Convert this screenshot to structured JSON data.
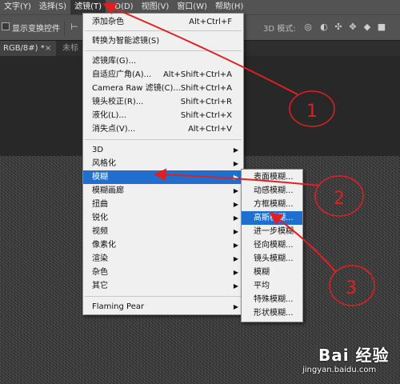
{
  "menubar": {
    "items": [
      "文字(Y)",
      "选择(S)",
      "滤镜(T)",
      "3D(D)",
      "视图(V)",
      "窗口(W)",
      "帮助(H)"
    ]
  },
  "options_bar": {
    "transform_label": "显示变换控件",
    "mode_label": "3D 模式:"
  },
  "tabs": [
    {
      "label": "RGB/8#) *",
      "close": "×"
    },
    {
      "label": "未标"
    }
  ],
  "filter_menu": {
    "items": [
      {
        "label": "添加杂色",
        "shortcut": "Alt+Ctrl+F"
      },
      {
        "label": "转换为智能滤镜(S)",
        "shortcut": ""
      },
      {
        "label": "滤镜库(G)...",
        "shortcut": ""
      },
      {
        "label": "自适应广角(A)...",
        "shortcut": "Alt+Shift+Ctrl+A"
      },
      {
        "label": "Camera Raw 滤镜(C)...",
        "shortcut": "Shift+Ctrl+A"
      },
      {
        "label": "镜头校正(R)...",
        "shortcut": "Shift+Ctrl+R"
      },
      {
        "label": "液化(L)...",
        "shortcut": "Shift+Ctrl+X"
      },
      {
        "label": "消失点(V)...",
        "shortcut": "Alt+Ctrl+V"
      },
      {
        "label": "3D",
        "arrow": "▶"
      },
      {
        "label": "风格化",
        "arrow": "▶"
      },
      {
        "label": "模糊",
        "arrow": "▶"
      },
      {
        "label": "模糊画廊",
        "arrow": "▶"
      },
      {
        "label": "扭曲",
        "arrow": "▶"
      },
      {
        "label": "锐化",
        "arrow": "▶"
      },
      {
        "label": "视频",
        "arrow": "▶"
      },
      {
        "label": "像素化",
        "arrow": "▶"
      },
      {
        "label": "渲染",
        "arrow": "▶"
      },
      {
        "label": "杂色",
        "arrow": "▶"
      },
      {
        "label": "其它",
        "arrow": "▶"
      },
      {
        "label": "Flaming Pear",
        "arrow": "▶"
      }
    ]
  },
  "blur_submenu": {
    "items": [
      "表面模糊...",
      "动感模糊...",
      "方框模糊...",
      "高斯模糊...",
      "进一步模糊",
      "径向模糊...",
      "镜头模糊...",
      "模糊",
      "平均",
      "特殊模糊...",
      "形状模糊..."
    ]
  },
  "annotations": [
    "1",
    "2",
    "3"
  ],
  "watermark": {
    "brand": "Bai 经验",
    "url": "jingyan.baidu.com"
  },
  "colors": {
    "highlight": "#1f6fd0",
    "annotation": "#e02020",
    "menu_bg": "#f0f0f0"
  }
}
